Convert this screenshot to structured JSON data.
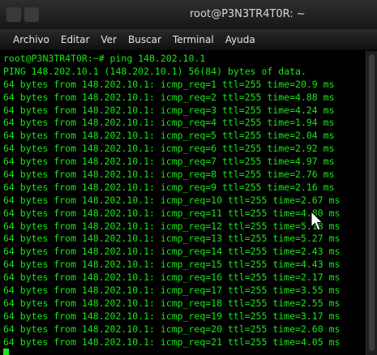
{
  "window": {
    "title": "root@P3N3TR4T0R: ~"
  },
  "menu": [
    {
      "label": "Archivo",
      "name": "menu-archivo"
    },
    {
      "label": "Editar",
      "name": "menu-editar"
    },
    {
      "label": "Ver",
      "name": "menu-ver"
    },
    {
      "label": "Buscar",
      "name": "menu-buscar"
    },
    {
      "label": "Terminal",
      "name": "menu-terminal"
    },
    {
      "label": "Ayuda",
      "name": "menu-ayuda"
    }
  ],
  "terminal": {
    "prompt": "root@P3N3TR4T0R:~# ping 148.202.10.1",
    "header": "PING 148.202.10.1 (148.202.10.1) 56(84) bytes of data.",
    "lines": [
      "64 bytes from 148.202.10.1: icmp_req=1 ttl=255 time=20.9 ms",
      "64 bytes from 148.202.10.1: icmp_req=2 ttl=255 time=4.88 ms",
      "64 bytes from 148.202.10.1: icmp_req=3 ttl=255 time=4.24 ms",
      "64 bytes from 148.202.10.1: icmp_req=4 ttl=255 time=1.94 ms",
      "64 bytes from 148.202.10.1: icmp_req=5 ttl=255 time=2.04 ms",
      "64 bytes from 148.202.10.1: icmp_req=6 ttl=255 time=2.92 ms",
      "64 bytes from 148.202.10.1: icmp_req=7 ttl=255 time=4.97 ms",
      "64 bytes from 148.202.10.1: icmp_req=8 ttl=255 time=2.76 ms",
      "64 bytes from 148.202.10.1: icmp_req=9 ttl=255 time=2.16 ms",
      "64 bytes from 148.202.10.1: icmp_req=10 ttl=255 time=2.67 ms",
      "64 bytes from 148.202.10.1: icmp_req=11 ttl=255 time=4.80 ms",
      "64 bytes from 148.202.10.1: icmp_req=12 ttl=255 time=5.18 ms",
      "64 bytes from 148.202.10.1: icmp_req=13 ttl=255 time=5.27 ms",
      "64 bytes from 148.202.10.1: icmp_req=14 ttl=255 time=2.43 ms",
      "64 bytes from 148.202.10.1: icmp_req=15 ttl=255 time=4.43 ms",
      "64 bytes from 148.202.10.1: icmp_req=16 ttl=255 time=2.17 ms",
      "64 bytes from 148.202.10.1: icmp_req=17 ttl=255 time=3.55 ms",
      "64 bytes from 148.202.10.1: icmp_req=18 ttl=255 time=2.55 ms",
      "64 bytes from 148.202.10.1: icmp_req=19 ttl=255 time=3.17 ms",
      "64 bytes from 148.202.10.1: icmp_req=20 ttl=255 time=2.60 ms",
      "64 bytes from 148.202.10.1: icmp_req=21 ttl=255 time=4.05 ms"
    ],
    "text_color": "#19e619",
    "background_color": "#000000"
  }
}
